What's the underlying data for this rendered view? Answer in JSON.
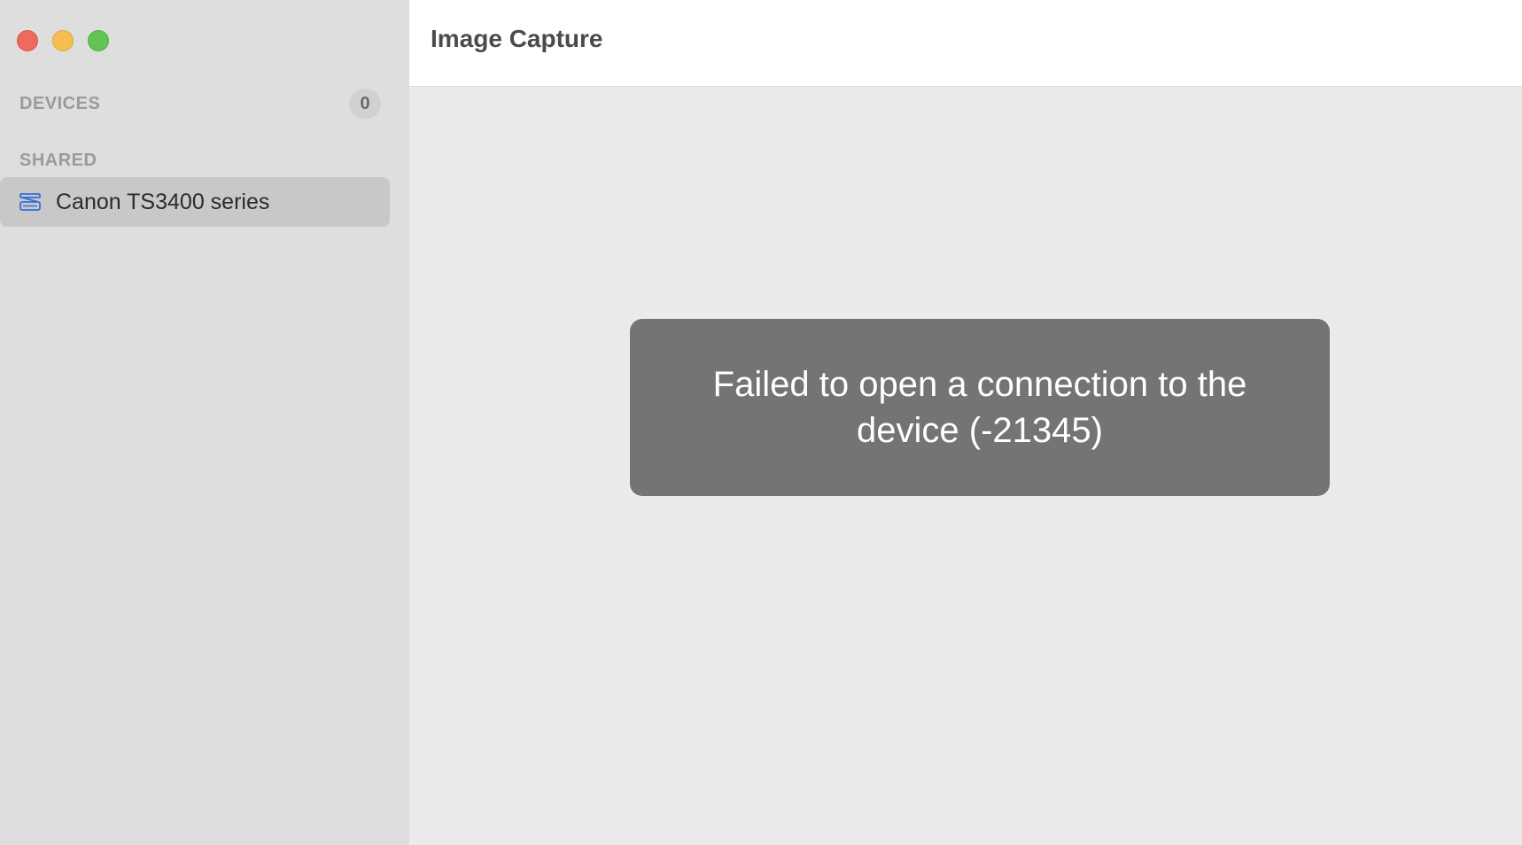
{
  "window": {
    "title": "Image Capture"
  },
  "sidebar": {
    "devices_header": "DEVICES",
    "devices_count": "0",
    "shared_header": "SHARED",
    "items": [
      {
        "label": "Canon TS3400 series",
        "icon": "scanner-icon",
        "selected": true
      }
    ]
  },
  "main": {
    "error_message": "Failed to open a connection to the device (-21345)"
  },
  "colors": {
    "close": "#ed6a5e",
    "minimize": "#f5bf4f",
    "zoom": "#61c454",
    "accent_icon": "#2f6fd8",
    "error_bg": "#747474"
  }
}
